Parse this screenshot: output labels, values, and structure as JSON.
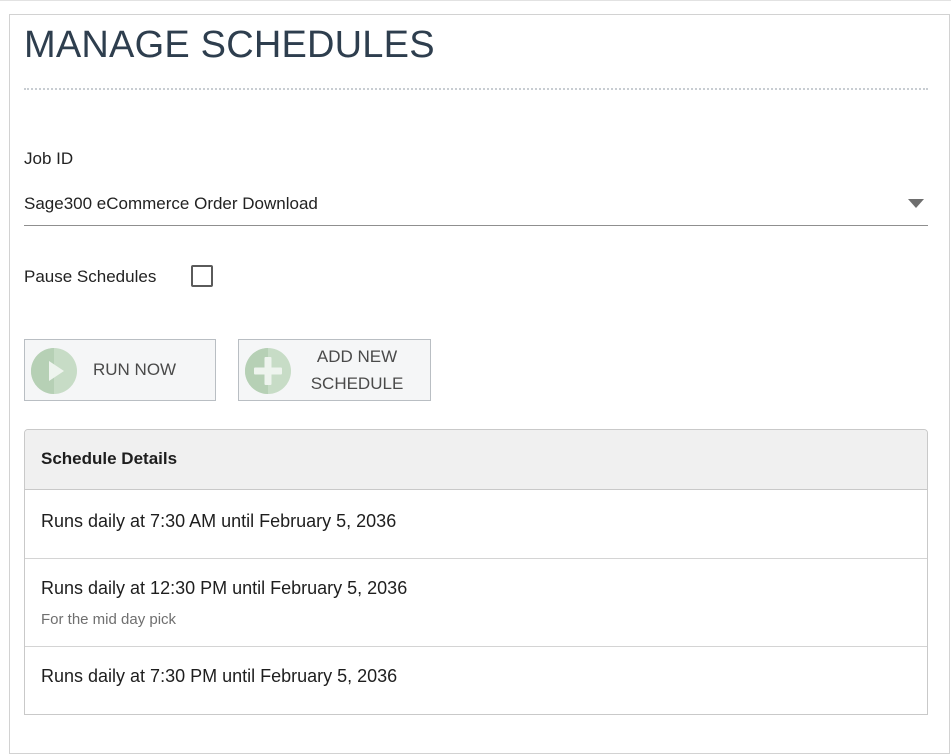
{
  "page": {
    "title": "MANAGE SCHEDULES"
  },
  "job": {
    "label": "Job ID",
    "selected": "Sage300 eCommerce Order Download"
  },
  "pause": {
    "label": "Pause Schedules",
    "checked": false
  },
  "buttons": {
    "run_now": "RUN NOW",
    "add_new_line1": "ADD NEW",
    "add_new_line2": "SCHEDULE"
  },
  "schedules": {
    "header": "Schedule Details",
    "items": [
      {
        "text": "Runs daily at 7:30 AM until February 5, 2036",
        "note": ""
      },
      {
        "text": "Runs daily at 12:30 PM until February 5, 2036",
        "note": "For the mid day pick"
      },
      {
        "text": "Runs daily at 7:30 PM until February 5, 2036",
        "note": ""
      }
    ]
  },
  "colors": {
    "title": "#2e3e4e",
    "icon_bg": "#c7dcc6",
    "panel_header_bg": "#f0f0f0"
  },
  "icons": {
    "run_now": "play-icon",
    "add_new": "plus-icon",
    "select": "chevron-down-icon"
  }
}
